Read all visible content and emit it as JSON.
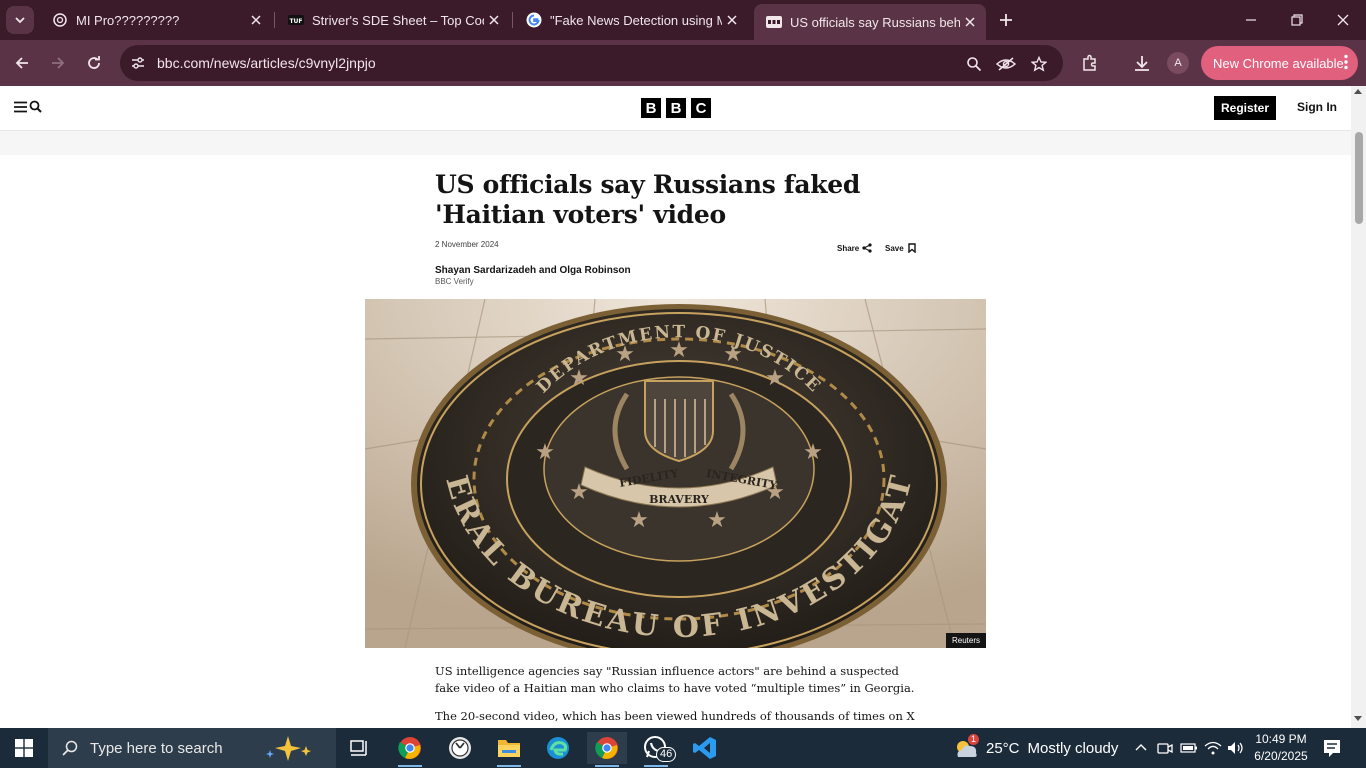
{
  "browser": {
    "tabs": [
      {
        "title": "MI Pro?????????",
        "favicon": "openai-icon",
        "active": false
      },
      {
        "title": "Striver's SDE Sheet – Top Coding",
        "favicon": "tuf-icon",
        "active": false
      },
      {
        "title": "\"Fake News Detection using Mu",
        "favicon": "google-icon",
        "active": false
      },
      {
        "title": "US officials say Russians behind",
        "favicon": "bbc-icon",
        "active": true
      }
    ],
    "url": "bbc.com/news/articles/c9vnyl2jnpjo",
    "profile_initial": "A",
    "new_chrome_label": "New Chrome available"
  },
  "bbc": {
    "logo_letters": [
      "B",
      "B",
      "C"
    ],
    "register_label": "Register",
    "signin_label": "Sign In"
  },
  "article": {
    "headline": "US officials say Russians faked 'Haitian voters' video",
    "date": "2 November 2024",
    "share_label": "Share",
    "save_label": "Save",
    "byline": "Shayan Sardarizadeh and Olga Robinson",
    "byline_org": "BBC Verify",
    "image_credit": "Reuters",
    "seal": {
      "top_text": "DEPARTMENT OF JUSTICE",
      "bottom_text": "FEDERAL BUREAU OF INVESTIGATION",
      "ribbon_left": "FIDELITY",
      "ribbon_center": "BRAVERY",
      "ribbon_right": "INTEGRITY"
    },
    "paragraphs": [
      "US intelligence agencies say \"Russian influence actors\" are behind a suspected fake video of a Haitian man who claims to have voted “multiple times” in Georgia.",
      "The 20-second video, which has been viewed hundreds of thousands of times on X"
    ]
  },
  "taskbar": {
    "search_placeholder": "Type here to search",
    "whatsapp_badge": "46",
    "weather_badge": "1",
    "temperature": "25°C",
    "weather_text": "Mostly cloudy",
    "time": "10:49 PM",
    "date": "6/20/2025"
  },
  "colors": {
    "tab_strip": "#3b1a29",
    "toolbar": "#5a3346",
    "new_chrome_accent": "#e0607e",
    "taskbar": "#1c2b3a"
  }
}
